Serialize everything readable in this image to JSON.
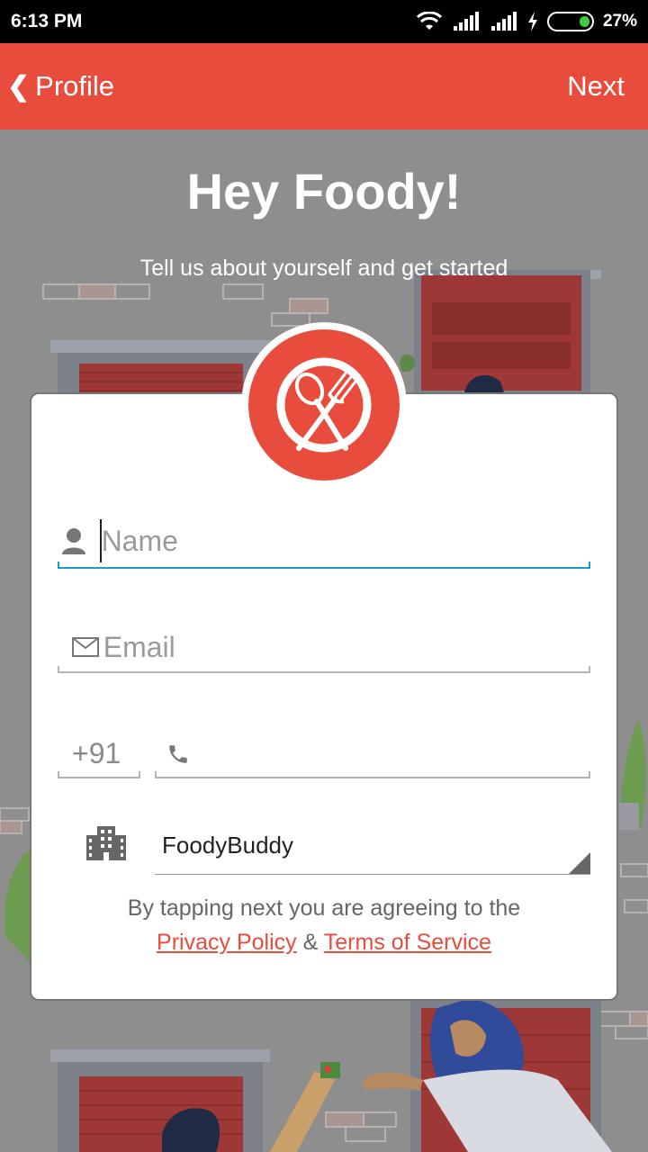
{
  "status_bar": {
    "time": "6:13 PM",
    "battery": "27%",
    "battery_level": 0.27
  },
  "app_bar": {
    "back_label": "Profile",
    "next_label": "Next"
  },
  "hero": {
    "title": "Hey Foody!",
    "subtitle": "Tell us about yourself and get started"
  },
  "form": {
    "name_placeholder": "Name",
    "email_placeholder": "Email",
    "country_code": "+91",
    "phone_placeholder": "",
    "company_value": "FoodyBuddy"
  },
  "terms": {
    "text": "By tapping next you are agreeing to the",
    "privacy_label": "Privacy Policy",
    "separator": "&",
    "tos_label": "Terms of Service"
  },
  "colors": {
    "brand": "#e84c3d",
    "accent": "#1a9bc8"
  }
}
